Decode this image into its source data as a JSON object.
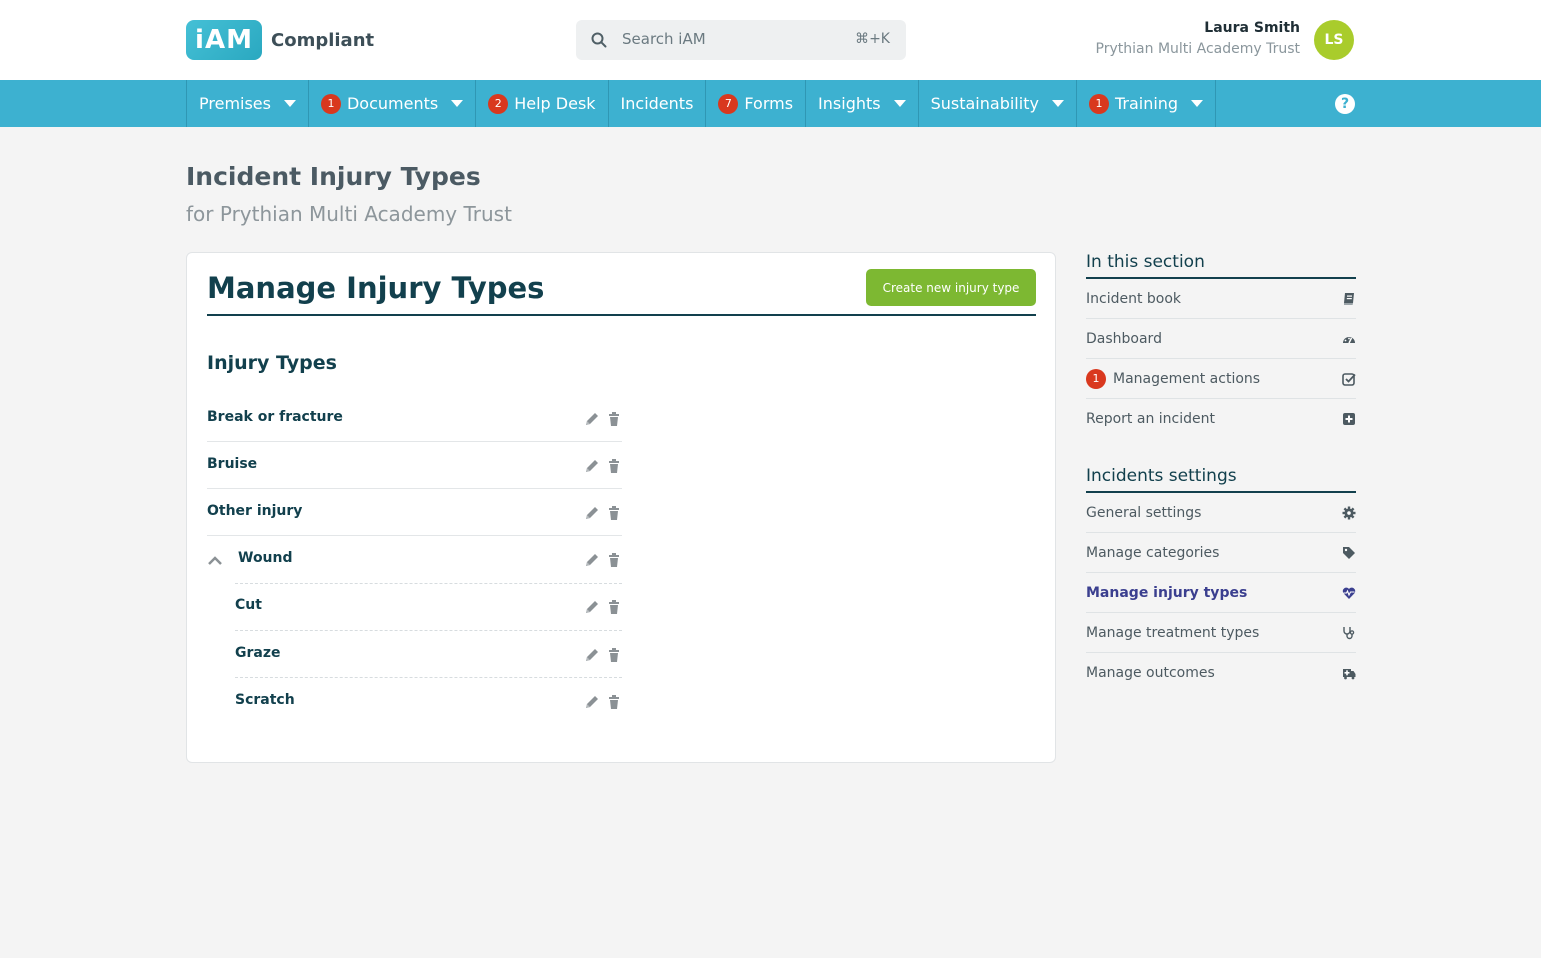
{
  "header": {
    "logo_mark": "iAM",
    "logo_text": "Compliant",
    "search_placeholder": "Search iAM",
    "search_shortcut": "⌘+K",
    "user_name": "Laura Smith",
    "user_org": "Prythian Multi Academy Trust",
    "avatar_initials": "LS"
  },
  "nav": {
    "items": [
      {
        "label": "Premises",
        "badge": "",
        "dropdown": true
      },
      {
        "label": "Documents",
        "badge": "1",
        "dropdown": true
      },
      {
        "label": "Help Desk",
        "badge": "2",
        "dropdown": false
      },
      {
        "label": "Incidents",
        "badge": "",
        "dropdown": false
      },
      {
        "label": "Forms",
        "badge": "7",
        "dropdown": false
      },
      {
        "label": "Insights",
        "badge": "",
        "dropdown": true
      },
      {
        "label": "Sustainability",
        "badge": "",
        "dropdown": true
      },
      {
        "label": "Training",
        "badge": "1",
        "dropdown": true
      }
    ],
    "help_icon": "?"
  },
  "page": {
    "title": "Incident Injury Types",
    "subtitle": "for Prythian Multi Academy Trust"
  },
  "card": {
    "title": "Manage Injury Types",
    "create_button": "Create new injury type",
    "section_title": "Injury Types",
    "rows": [
      {
        "label": "Break or fracture"
      },
      {
        "label": "Bruise"
      },
      {
        "label": "Other injury"
      },
      {
        "label": "Wound"
      },
      {
        "label": "Cut"
      },
      {
        "label": "Graze"
      },
      {
        "label": "Scratch"
      }
    ]
  },
  "sidebar": {
    "section_heading": "In this section",
    "section_items": [
      {
        "label": "Incident book",
        "icon": "book-icon",
        "badge": ""
      },
      {
        "label": "Dashboard",
        "icon": "dashboard-icon",
        "badge": ""
      },
      {
        "label": "Management actions",
        "icon": "checkbox-icon",
        "badge": "1"
      },
      {
        "label": "Report an incident",
        "icon": "plus-square-icon",
        "badge": ""
      }
    ],
    "settings_heading": "Incidents settings",
    "settings_items": [
      {
        "label": "General settings",
        "icon": "gear-icon"
      },
      {
        "label": "Manage categories",
        "icon": "tag-icon"
      },
      {
        "label": "Manage injury types",
        "icon": "heart-pulse-icon"
      },
      {
        "label": "Manage treatment types",
        "icon": "stethoscope-icon"
      },
      {
        "label": "Manage outcomes",
        "icon": "ambulance-icon"
      }
    ]
  },
  "colors": {
    "nav_bg": "#3db1d0",
    "badge": "#d9381e",
    "create_button": "#7db832",
    "heading": "#12404d",
    "active_link": "#3b3f8f"
  }
}
